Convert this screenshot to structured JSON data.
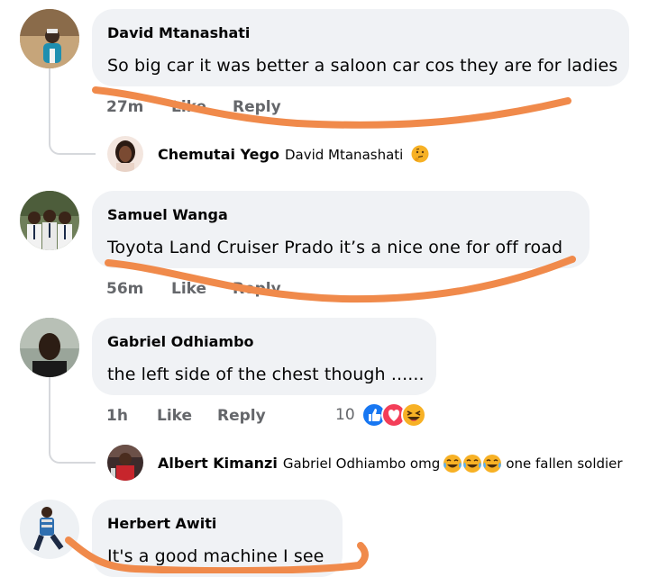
{
  "comments": [
    {
      "author": "David Mtanashati",
      "text": "So big car it was better a saloon car cos they are for ladies",
      "time": "27m",
      "like": "Like",
      "reply": "Reply",
      "replies": [
        {
          "author": "Chemutai Yego",
          "text": "David Mtanashati",
          "emoji_icon": "thinking-face-icon"
        }
      ]
    },
    {
      "author": "Samuel Wanga",
      "text": "Toyota Land Cruiser Prado it’s a nice one for off road",
      "time": "56m",
      "like": "Like",
      "reply": "Reply"
    },
    {
      "author": "Gabriel Odhiambo",
      "text": "the left side of the chest though ......",
      "time": "1h",
      "like": "Like",
      "reply": "Reply",
      "reaction_count": "10",
      "reactions": [
        "like-reaction-icon",
        "love-reaction-icon",
        "haha-reaction-icon"
      ],
      "replies": [
        {
          "author": "Albert Kimanzi",
          "text_before": "Gabriel Odhiambo omg",
          "emoji_icons": [
            "crying-laughing-icon",
            "crying-laughing-icon",
            "crying-laughing-icon"
          ],
          "text_after": "one fallen soldier"
        }
      ]
    },
    {
      "author": "Herbert Awiti",
      "text": "It's a good machine I see"
    }
  ],
  "colors": {
    "bubble": "#f0f2f5",
    "meta_text": "#65676b",
    "annotation_stroke": "#f08a4b",
    "like_blue": "#1877f2",
    "love_red": "#f33e58",
    "emoji_yellow": "#f7b125"
  }
}
